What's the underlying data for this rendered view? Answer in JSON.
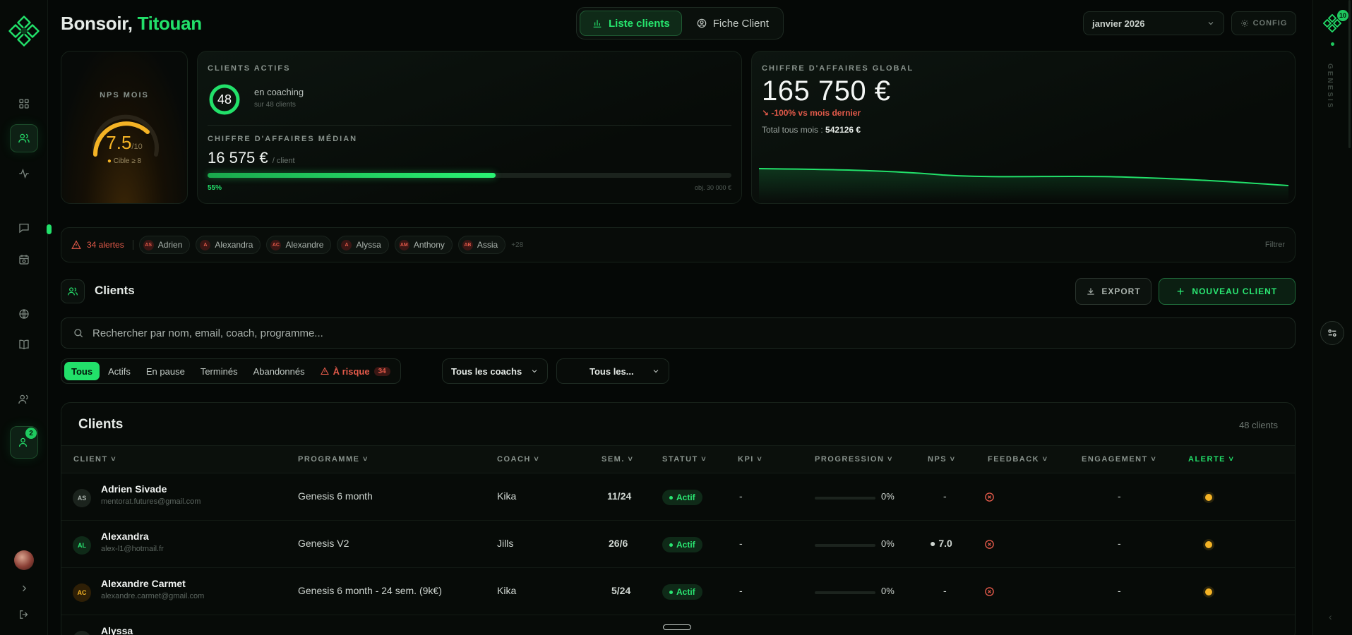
{
  "header": {
    "greeting_prefix": "Bonsoir,",
    "user_name": "Titouan",
    "views": [
      "Liste clients",
      "Fiche Client"
    ],
    "month": "janvier 2026",
    "config_label": "CONFIG"
  },
  "left_rail": {
    "notification_count": "2"
  },
  "right_rail": {
    "badge_count": "10",
    "label": "GENESIS"
  },
  "kpis": {
    "nps": {
      "label": "NPS MOIS",
      "value": "7.5",
      "scale": "/10",
      "target": "Cible ≥ 8"
    },
    "actifs": {
      "label": "CLIENTS ACTIFS",
      "count": "48",
      "sub": "en coaching",
      "sub2": "sur 48 clients",
      "median_label": "CHIFFRE D'AFFAIRES MÉDIAN",
      "median_value": "16 575 €",
      "median_unit": "/ client",
      "progress_pct": "55%",
      "progress_fraction": 0.55,
      "objective": "obj. 30 000 €"
    },
    "ca": {
      "label": "CHIFFRE D'AFFAIRES GLOBAL",
      "value": "165 750 €",
      "delta": "-100% vs mois dernier",
      "total_label": "Total tous mois :",
      "total_value": "542126 €"
    }
  },
  "alerts": {
    "count_label": "34 alertes",
    "chips": [
      {
        "initials": "AS",
        "name": "Adrien"
      },
      {
        "initials": "A",
        "name": "Alexandra"
      },
      {
        "initials": "AC",
        "name": "Alexandre"
      },
      {
        "initials": "A",
        "name": "Alyssa"
      },
      {
        "initials": "AM",
        "name": "Anthony"
      },
      {
        "initials": "AB",
        "name": "Assia"
      }
    ],
    "more": "+28",
    "filter_label": "Filtrer"
  },
  "clients_section": {
    "title": "Clients",
    "export_label": "EXPORT",
    "new_label": "NOUVEAU CLIENT",
    "search_placeholder": "Rechercher par nom, email, coach, programme...",
    "tabs": [
      "Tous",
      "Actifs",
      "En pause",
      "Terminés",
      "Abandonnés",
      "À risque"
    ],
    "risk_count": "34",
    "coach_filter": "Tous les coachs",
    "program_filter": "Tous les..."
  },
  "table": {
    "title": "Clients",
    "count": "48 clients",
    "columns": [
      "CLIENT",
      "PROGRAMME",
      "COACH",
      "SEM.",
      "STATUT",
      "KPI",
      "PROGRESSION",
      "NPS",
      "FEEDBACK",
      "ENGAGEMENT",
      "ALERTE"
    ],
    "rows": [
      {
        "initials": "AS",
        "name": "Adrien Sivade",
        "email": "mentorat.futures@gmail.com",
        "program": "Genesis 6 month",
        "coach": "Kika",
        "week": "11/24",
        "status": "Actif",
        "kpi": "-",
        "progress": "0%",
        "nps": "-",
        "engagement": "-"
      },
      {
        "initials": "AL",
        "name": "Alexandra",
        "email": "alex-l1@hotmail.fr",
        "program": "Genesis V2",
        "coach": "Jills",
        "week": "26/6",
        "status": "Actif",
        "kpi": "-",
        "progress": "0%",
        "nps": "7.0",
        "engagement": "-"
      },
      {
        "initials": "AC",
        "name": "Alexandre Carmet",
        "email": "alexandre.carmet@gmail.com",
        "program": "Genesis 6 month - 24 sem. (9k€)",
        "coach": "Kika",
        "week": "5/24",
        "status": "Actif",
        "kpi": "-",
        "progress": "0%",
        "nps": "-",
        "engagement": "-"
      },
      {
        "initials": "A",
        "name": "Alyssa",
        "email": "",
        "program": "",
        "coach": "",
        "week": "",
        "status": "",
        "kpi": "",
        "progress": "",
        "nps": "",
        "engagement": ""
      }
    ]
  },
  "colors": {
    "accent": "#22e06a",
    "warning": "#f4b325",
    "danger": "#e35a4a",
    "background": "#050806"
  },
  "icons": [
    "app-logo-icon",
    "grid-icon",
    "users-icon",
    "activity-icon",
    "chat-icon",
    "calendar-clock-icon",
    "globe-icon",
    "book-icon",
    "user-group-icon",
    "user-badge-icon",
    "chevron-right-icon",
    "logout-icon",
    "bar-chart-icon",
    "user-circle-icon",
    "chevron-down-icon",
    "gear-icon",
    "warning-icon",
    "download-icon",
    "plus-icon",
    "search-icon",
    "x-circle-icon"
  ]
}
